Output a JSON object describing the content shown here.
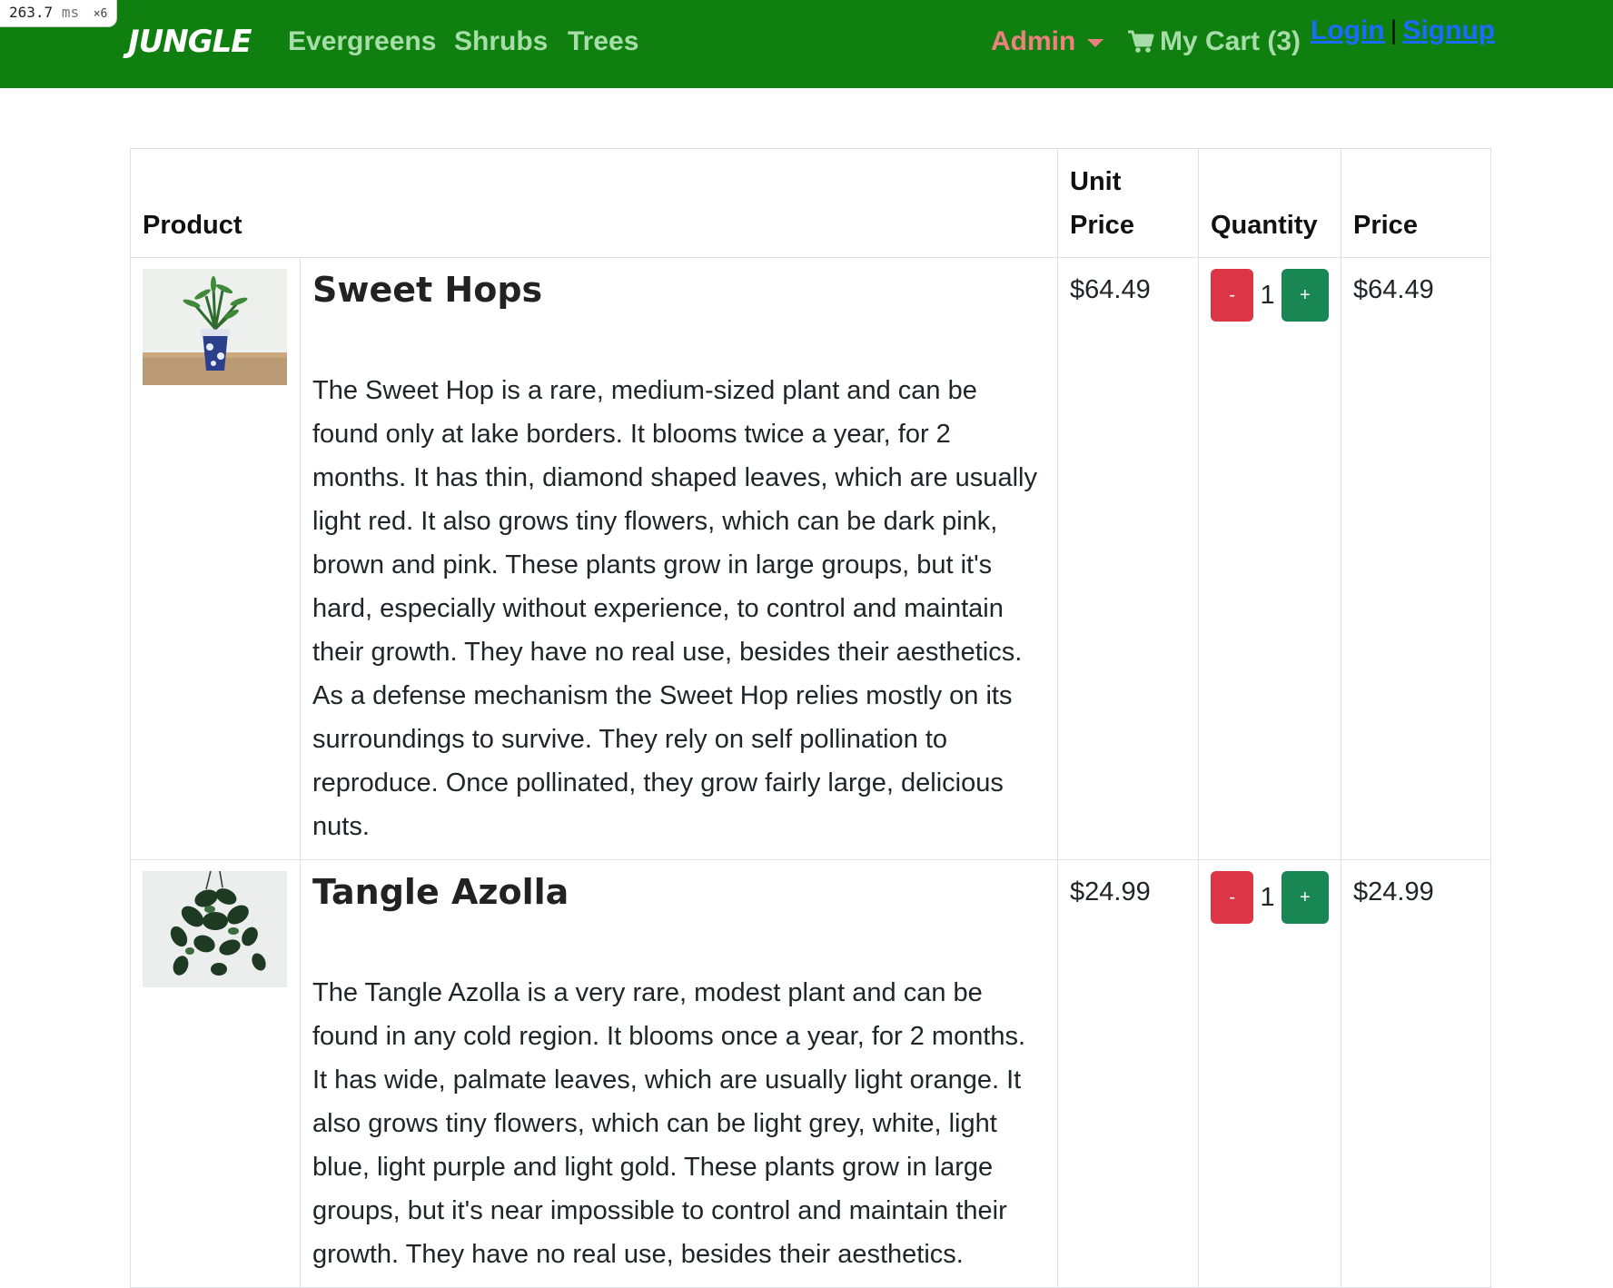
{
  "perf": {
    "value": "263.7",
    "unit": "ms",
    "mult": "×6"
  },
  "nav": {
    "brand": "JUNGLE",
    "links": [
      "Evergreens",
      "Shrubs",
      "Trees"
    ],
    "admin": "Admin",
    "cart": "My Cart (3)",
    "login": "Login",
    "signup": "Signup",
    "separator": "|"
  },
  "table": {
    "headers": {
      "product": "Product",
      "unit_price_line1": "Unit",
      "unit_price_line2": "Price",
      "quantity": "Quantity",
      "price": "Price"
    },
    "minus_label": "-",
    "plus_label": "+",
    "rows": [
      {
        "name": "Sweet Hops",
        "description": "The Sweet Hop is a rare, medium-sized plant and can be found only at lake borders. It blooms twice a year, for 2 months. It has thin, diamond shaped leaves, which are usually light red. It also grows tiny flowers, which can be dark pink, brown and pink. These plants grow in large groups, but it's hard, especially without experience, to control and maintain their growth. They have no real use, besides their aesthetics. As a defense mechanism the Sweet Hop relies mostly on its surroundings to survive. They rely on self pollination to reproduce. Once pollinated, they grow fairly large, delicious nuts.",
        "unit_price": "$64.49",
        "quantity": "1",
        "price": "$64.49"
      },
      {
        "name": "Tangle Azolla",
        "description": "The Tangle Azolla is a very rare, modest plant and can be found in any cold region. It blooms once a year, for 2 months. It has wide, palmate leaves, which are usually light orange. It also grows tiny flowers, which can be light grey, white, light blue, light purple and light gold. These plants grow in large groups, but it's near impossible to control and maintain their growth. They have no real use, besides their aesthetics.",
        "unit_price": "$24.99",
        "quantity": "1",
        "price": "$24.99"
      }
    ]
  }
}
